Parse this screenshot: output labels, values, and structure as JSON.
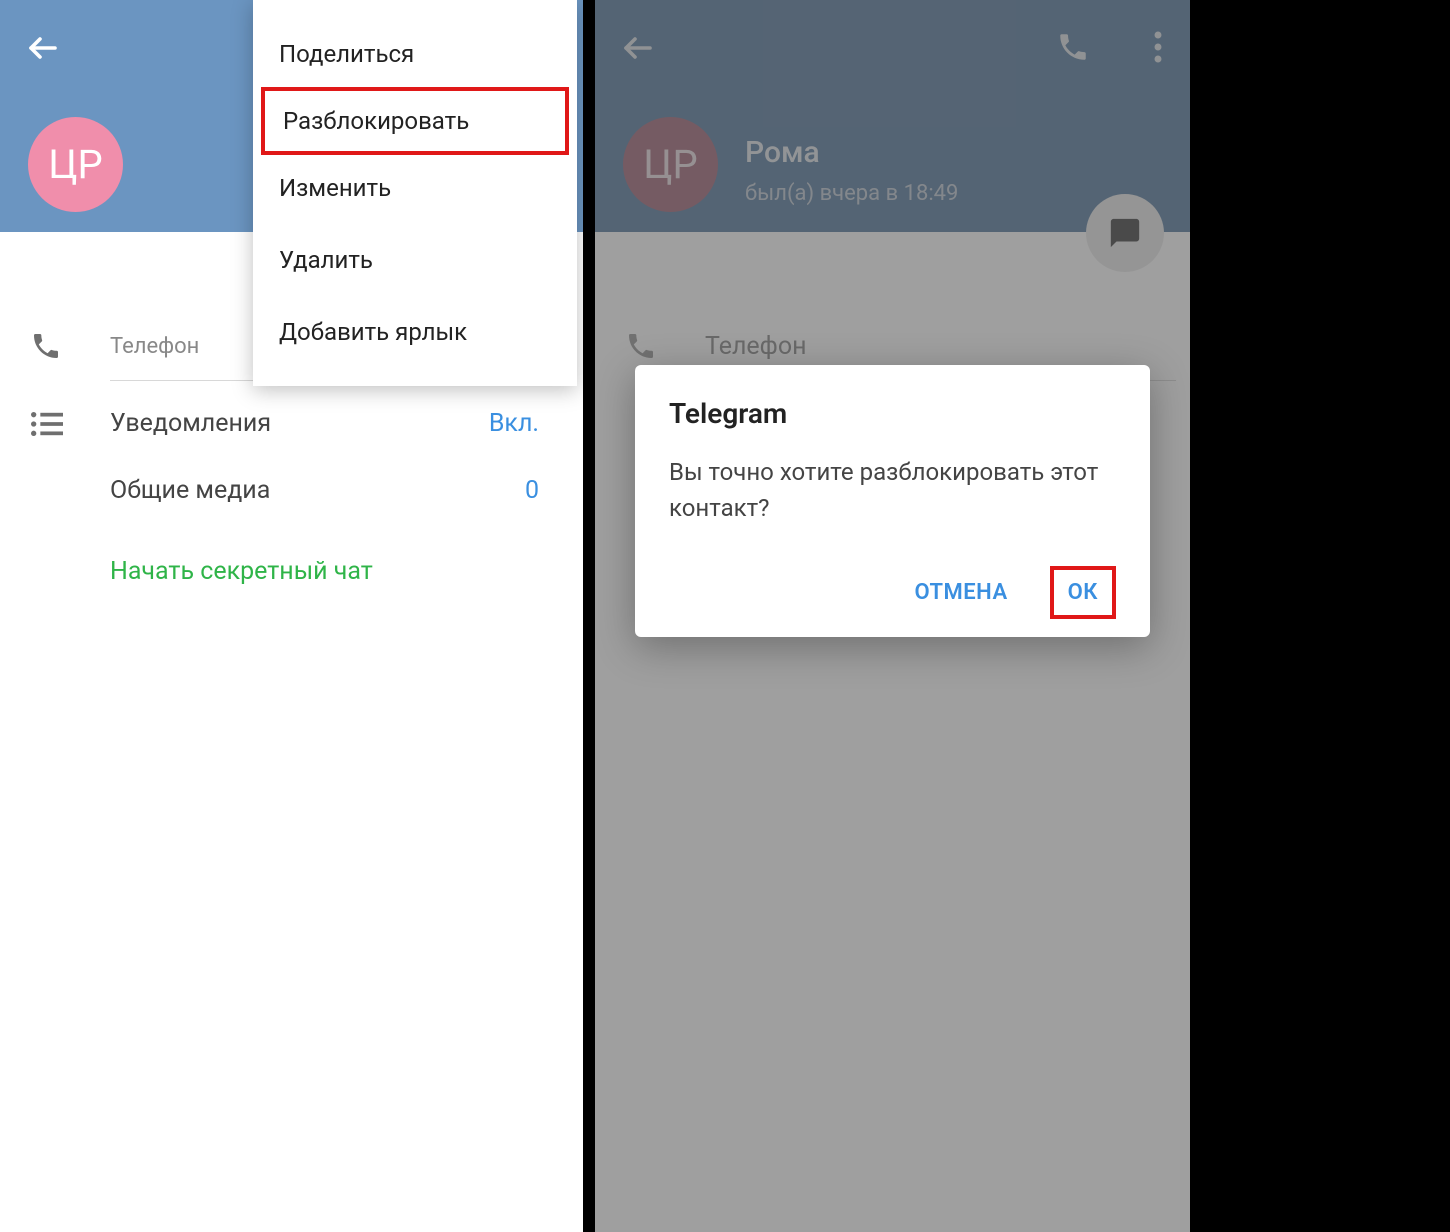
{
  "left": {
    "avatar_initials": "ЦР",
    "menu": {
      "share": "Поделиться",
      "unblock": "Разблокировать",
      "edit": "Изменить",
      "delete": "Удалить",
      "add_shortcut": "Добавить ярлык"
    },
    "phone_label": "Телефон",
    "notifications_label": "Уведомления",
    "notifications_value": "Вкл.",
    "shared_media_label": "Общие медиа",
    "shared_media_value": "0",
    "secret_chat": "Начать секретный чат"
  },
  "right": {
    "avatar_initials": "ЦР",
    "contact_name": "Рома",
    "last_seen": "был(а) вчера в 18:49",
    "phone_label": "Телефон",
    "dialog": {
      "title": "Telegram",
      "message": "Вы точно хотите разблокировать этот контакт?",
      "cancel": "ОТМЕНА",
      "ok": "ОК"
    }
  }
}
